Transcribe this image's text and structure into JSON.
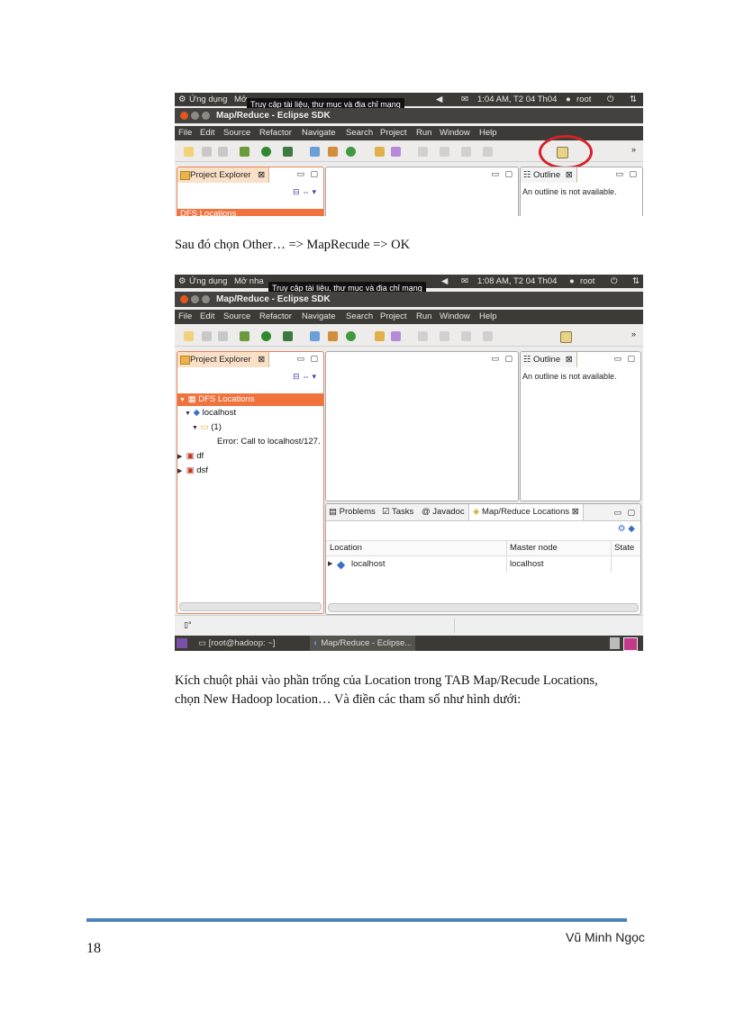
{
  "shot1": {
    "topbar": {
      "apps": "Ứng dụng",
      "places_partial": "Mở",
      "time": "1:04 AM, T2 04 Th04",
      "user": "root"
    },
    "tooltip": "Truy cập tài liệu, thư mục và địa chỉ mạng",
    "window_title": "Map/Reduce - Eclipse SDK",
    "menu": [
      "File",
      "Edit",
      "Source",
      "Refactor",
      "Navigate",
      "Search",
      "Project",
      "Run",
      "Window",
      "Help"
    ],
    "project_explorer_tab": "Project Explorer",
    "outline_tab": "Outline",
    "outline_text": "An outline is not available.",
    "tree_partial": "DFS Locations"
  },
  "para1": "Sau đó chọn Other… => MapRecude => OK",
  "shot2": {
    "topbar": {
      "apps": "Ứng dụng",
      "places_partial": "Mở nha",
      "time": "1:08 AM, T2 04 Th04",
      "user": "root"
    },
    "tooltip": "Truy cập tài liệu, thư mục và địa chỉ mạng",
    "window_title": "Map/Reduce - Eclipse SDK",
    "menu": [
      "File",
      "Edit",
      "Source",
      "Refactor",
      "Navigate",
      "Search",
      "Project",
      "Run",
      "Window",
      "Help"
    ],
    "project_explorer_tab": "Project Explorer",
    "outline_tab": "Outline",
    "outline_text": "An outline is not available.",
    "tree": {
      "dfs": "DFS Locations",
      "localhost": "localhost",
      "folder": "(1)",
      "error": "Error: Call to localhost/127.",
      "df": "df",
      "dsf": "dsf"
    },
    "bottom_tabs": {
      "problems": "Problems",
      "tasks": "Tasks",
      "javadoc": "Javadoc",
      "mr": "Map/Reduce Locations"
    },
    "columns": {
      "location": "Location",
      "master": "Master node",
      "state": "State"
    },
    "row": {
      "location": "localhost",
      "master": "localhost"
    },
    "taskbar": {
      "terminal": "[root@hadoop: ~]",
      "eclipse": "Map/Reduce - Eclipse..."
    }
  },
  "para2_line1": "Kích chuột phải vào phần trống của  Location trong TAB Map/Recude Locations,",
  "para2_line2": "chọn New Hadoop location… Và điền các tham số như hình dưới:",
  "footer": {
    "page_number": "18",
    "author": "Vũ Minh Ngọc"
  },
  "colors": {
    "ubuntu_dark": "#3b3a36",
    "eclipse_tab_orange": "#f0733e",
    "highlight_circle": "#d0232a",
    "rule_blue": "#4f81bd"
  }
}
